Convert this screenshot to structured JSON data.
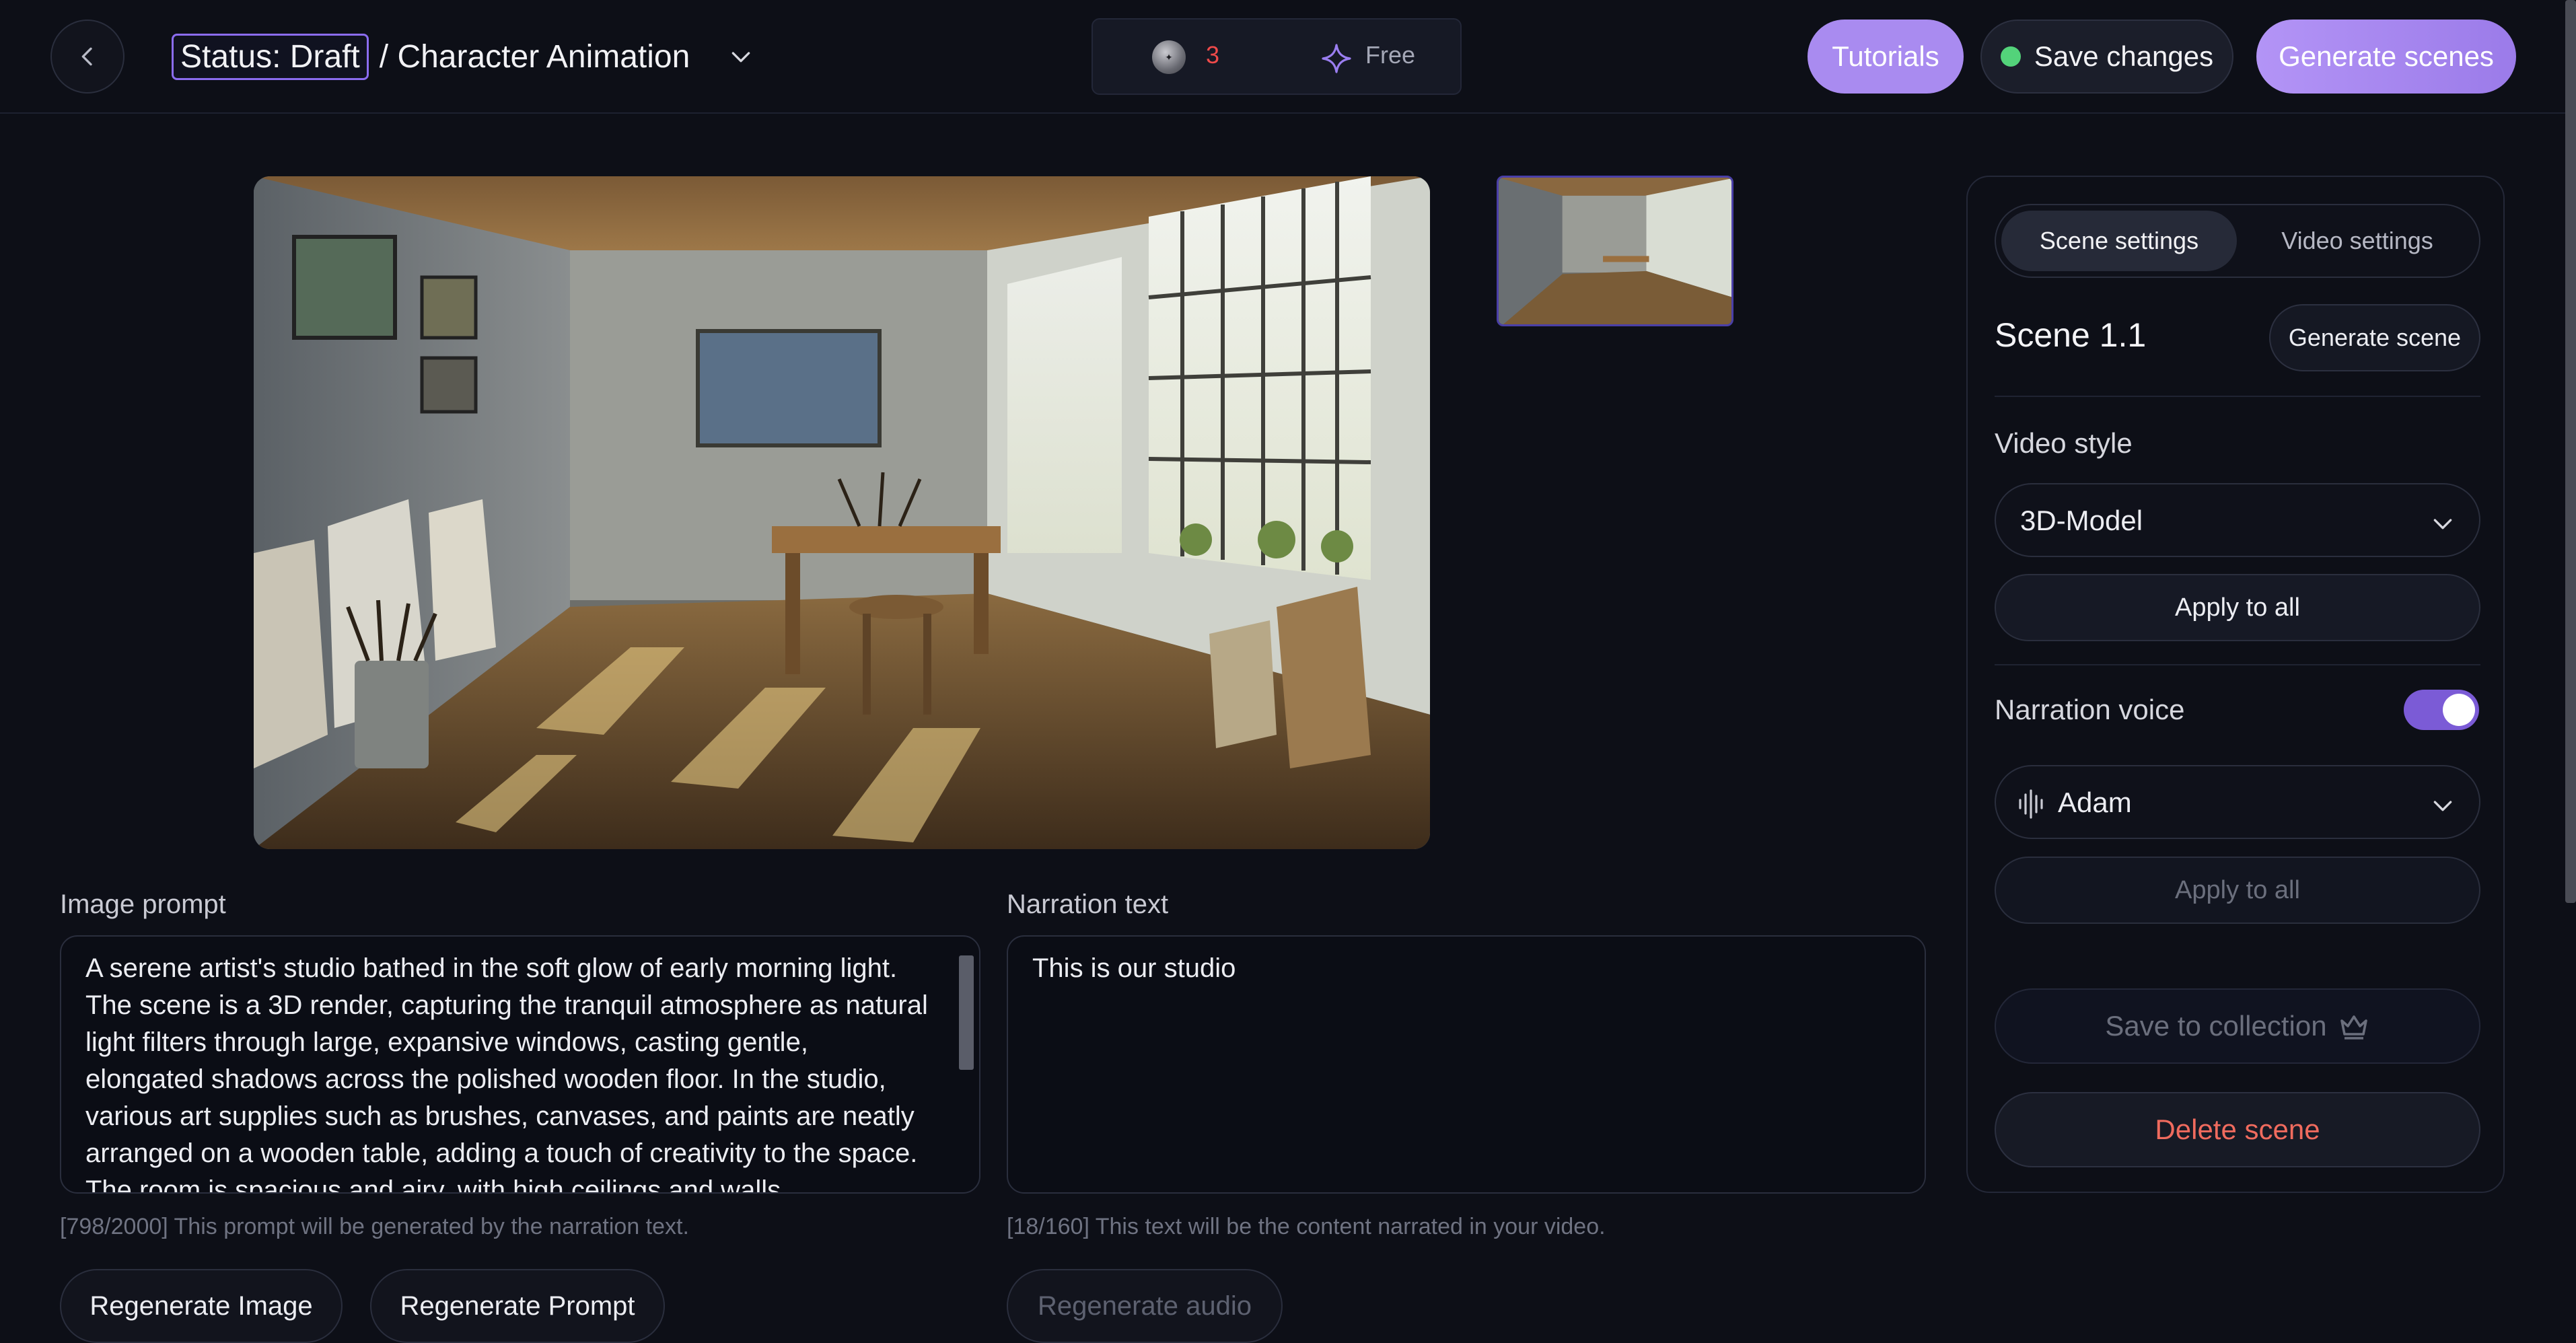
{
  "header": {
    "status_label": "Status: Draft",
    "project_title": "/ Character Animation",
    "credits": "3",
    "plan": "Free",
    "tutorials_label": "Tutorials",
    "save_label": "Save changes",
    "generate_label": "Generate scenes"
  },
  "editor": {
    "image_prompt_label": "Image prompt",
    "image_prompt_value": "A serene artist's studio bathed in the soft glow of early morning light. The scene is a 3D render, capturing the tranquil atmosphere as natural light filters through large, expansive windows, casting gentle, elongated shadows across the polished wooden floor. In the studio, various art supplies such as brushes, canvases, and paints are neatly arranged on a wooden table, adding a touch of creativity to the space. The room is spacious and airy, with high ceilings and walls",
    "image_prompt_hint": "[798/2000] This prompt will be generated by the narration text.",
    "narration_label": "Narration text",
    "narration_value": "This is our studio",
    "narration_hint": "[18/160] This text will be the content narrated in your video.",
    "regen_image_label": "Regenerate Image",
    "regen_prompt_label": "Regenerate Prompt",
    "regen_audio_label": "Regenerate audio"
  },
  "panel": {
    "tabs": [
      "Scene settings",
      "Video settings"
    ],
    "scene_title": "Scene 1.1",
    "generate_scene_label": "Generate scene",
    "video_style_label": "Video style",
    "video_style_value": "3D-Model",
    "apply_all_label": "Apply to all",
    "narration_voice_label": "Narration voice",
    "narration_voice_on": true,
    "voice_value": "Adam",
    "apply_all_voice_label": "Apply to all",
    "save_collection_label": "Save to collection",
    "delete_label": "Delete scene"
  },
  "colors": {
    "accent": "#a98bf0",
    "status_ok": "#53d37a",
    "danger": "#f06b5e",
    "credits": "#ef4a4a"
  },
  "icons": [
    "chevron-left-icon",
    "chevron-down-icon",
    "coin-icon",
    "sparkle-icon",
    "audio-wave-icon",
    "crown-icon"
  ]
}
